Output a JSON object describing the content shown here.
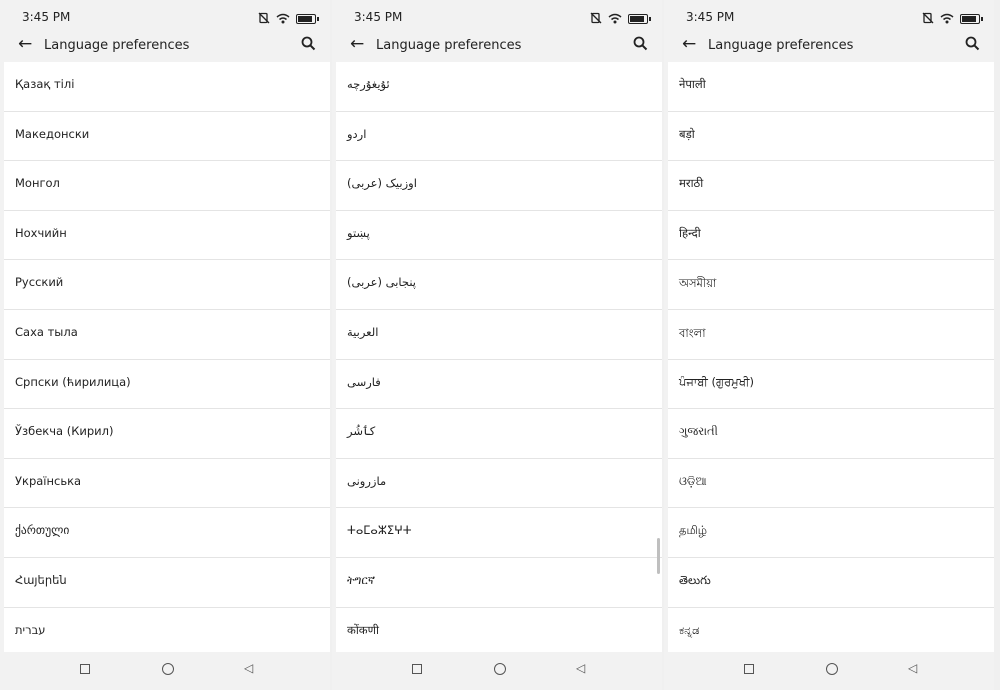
{
  "status_time": "3:45 PM",
  "app_bar": {
    "title": "Language preferences"
  },
  "screens": [
    {
      "languages": [
        "Қазақ тілі",
        "Македонски",
        "Монгол",
        "Нохчийн",
        "Русский",
        "Саха тыла",
        "Српски (ћирилица)",
        "Ўзбекча (Кирил)",
        "Українська",
        "ქართული",
        "Հայերեն",
        "עברית"
      ]
    },
    {
      "languages": [
        "ئۇيغۇرچە",
        "اردو",
        "اوزبیک (عربی)",
        "پښتو",
        "پنجابی (عربی)",
        "العربية",
        "فارسی",
        "کٲشُر",
        "مازرونی",
        "ⵜⴰⵎⴰⵣⵉⵖⵜ",
        "ትግርኛ",
        "कोंकणी"
      ]
    },
    {
      "languages": [
        "नेपाली",
        "बड़ो",
        "मराठी",
        "हिन्दी",
        "অসমীয়া",
        "বাংলা",
        "ਪੰਜਾਬੀ (ਗੁਰਮੁਖੀ)",
        "ગુજરાતી",
        "ଓଡ଼ିଆ",
        "தமிழ்",
        "తెలుగు",
        "ಕನ್ನಡ"
      ]
    }
  ],
  "icons": {
    "back": "arrow-left-icon",
    "search": "search-icon",
    "status": [
      "mute-icon",
      "wifi-icon",
      "battery-icon"
    ],
    "nav": [
      "recents-square-icon",
      "home-circle-icon",
      "back-triangle-icon"
    ]
  }
}
